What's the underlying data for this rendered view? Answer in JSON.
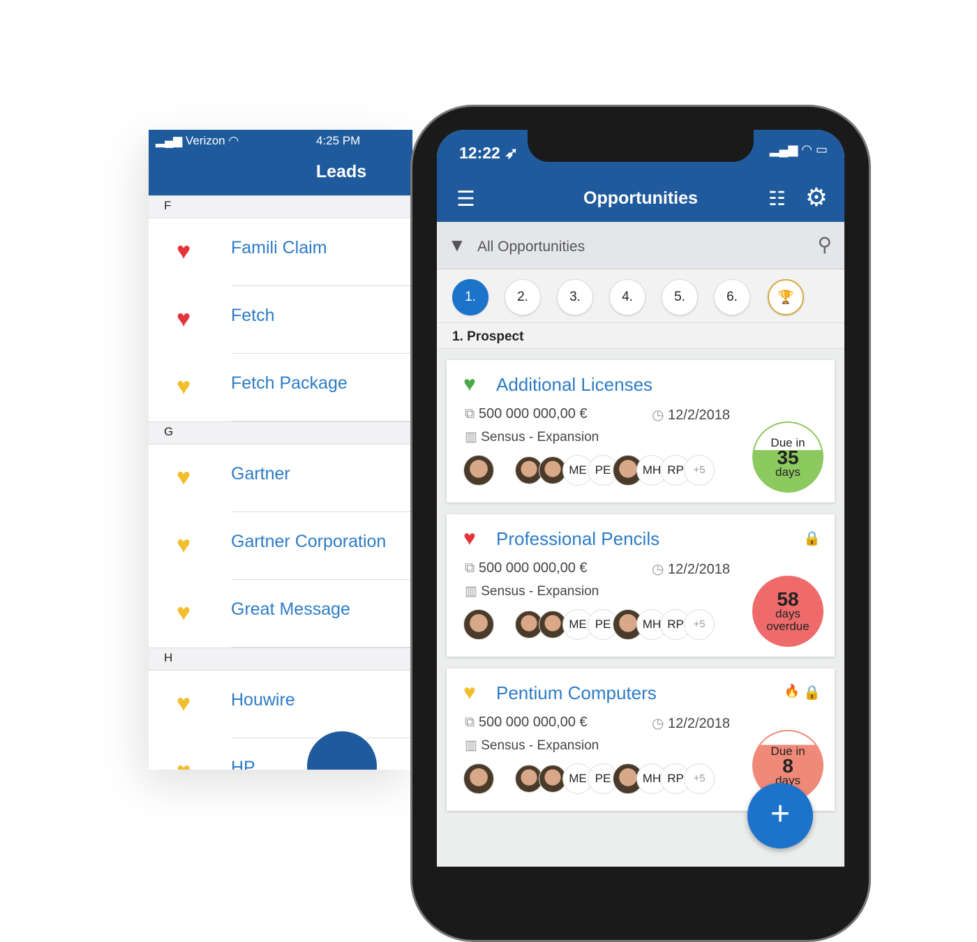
{
  "leads": {
    "status": {
      "carrier": "Verizon",
      "time": "4:25 PM"
    },
    "title": "Leads",
    "sections": [
      {
        "letter": "F",
        "items": [
          {
            "name": "Famili Claim",
            "heart": "red"
          },
          {
            "name": "Fetch",
            "heart": "red"
          },
          {
            "name": "Fetch Package",
            "heart": "yellow"
          }
        ]
      },
      {
        "letter": "G",
        "items": [
          {
            "name": "Gartner",
            "heart": "yellow"
          },
          {
            "name": "Gartner Corporation",
            "heart": "yellow"
          },
          {
            "name": "Great Message",
            "heart": "yellow"
          }
        ]
      },
      {
        "letter": "H",
        "items": [
          {
            "name": "Houwire",
            "heart": "yellow"
          },
          {
            "name": "HP",
            "heart": "yellow"
          }
        ]
      }
    ]
  },
  "opps": {
    "time": "12:22",
    "title": "Opportunities",
    "filter": "All Opportunities",
    "stages": [
      "1.",
      "2.",
      "3.",
      "4.",
      "5.",
      "6."
    ],
    "active_stage": "1.",
    "section": "1. Prospect",
    "cards": [
      {
        "title": "Additional Licenses",
        "heart": "green",
        "amount": "500 000 000,00 €",
        "date": "12/2/2018",
        "company": "Sensus - Expansion",
        "badge_top": "Due in",
        "badge_num": "35",
        "badge_bottom": "days",
        "badge_color": "#8cc95f",
        "badge_fill": 0.6,
        "locked": false,
        "hot": false
      },
      {
        "title": "Professional Pencils",
        "heart": "red",
        "amount": "500 000 000,00 €",
        "date": "12/2/2018",
        "company": "Sensus - Expansion",
        "badge_top": "",
        "badge_num": "58",
        "badge_bottom": "days overdue",
        "badge_color": "#ef6b6b",
        "badge_fill": 1,
        "locked": true,
        "hot": false
      },
      {
        "title": "Pentium Computers",
        "heart": "yellow",
        "amount": "500 000 000,00 €",
        "date": "12/2/2018",
        "company": "Sensus - Expansion",
        "badge_top": "Due in",
        "badge_num": "8",
        "badge_bottom": "days",
        "badge_color": "#f08a78",
        "badge_fill": 0.8,
        "locked": true,
        "hot": true
      }
    ],
    "team": [
      "ME",
      "PE",
      "MH",
      "RP",
      "+5"
    ],
    "colors": {
      "primary": "#1f5b9c",
      "accent": "#1c73c9",
      "link": "#2c7bc6"
    }
  }
}
